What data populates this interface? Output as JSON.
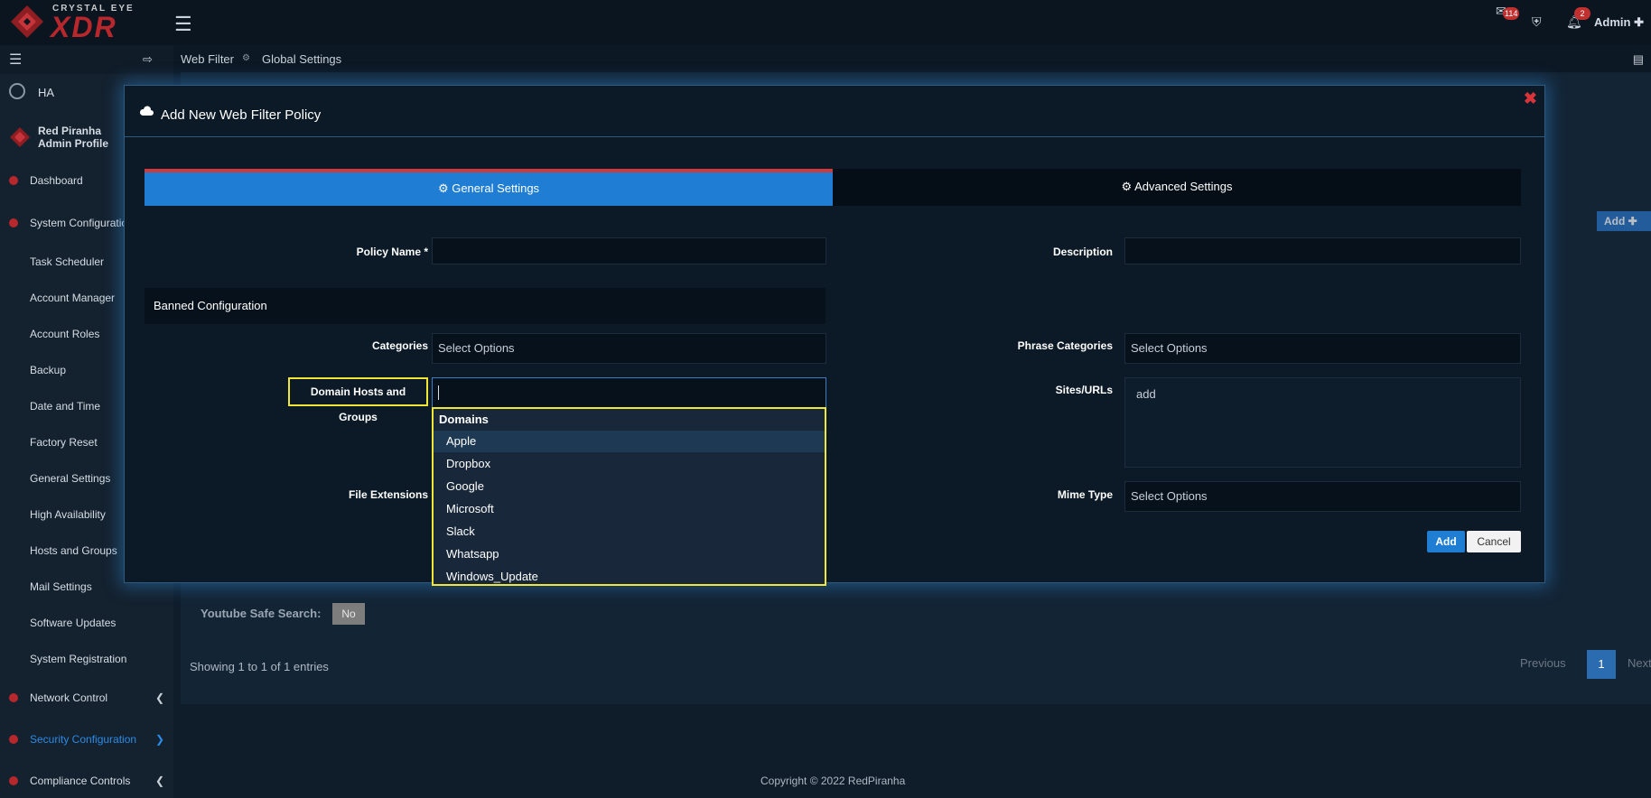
{
  "topbar": {
    "brand_small": "CRYSTAL EYE",
    "brand_main": "XDR",
    "mail_badge": "114",
    "alert_badge": "2",
    "admin_label": "Admin"
  },
  "sidebar": {
    "ha_label": "HA",
    "profile_name": "Red Piranha",
    "profile_role": "Admin Profile",
    "items": [
      {
        "label": "Dashboard"
      },
      {
        "label": "System Configuration"
      },
      {
        "label": "Task Scheduler"
      },
      {
        "label": "Account Manager"
      },
      {
        "label": "Account Roles"
      },
      {
        "label": "Backup"
      },
      {
        "label": "Date and Time"
      },
      {
        "label": "Factory Reset"
      },
      {
        "label": "General Settings"
      },
      {
        "label": "High Availability"
      },
      {
        "label": "Hosts and Groups"
      },
      {
        "label": "Mail Settings"
      },
      {
        "label": "Software Updates"
      },
      {
        "label": "System Registration"
      },
      {
        "label": "Network Control"
      },
      {
        "label": "Security Configuration"
      },
      {
        "label": "Compliance Controls"
      }
    ]
  },
  "breadcrumb": {
    "first": "Web Filter",
    "second": "Global Settings"
  },
  "background": {
    "add_button": "Add",
    "youtube_label": "Youtube Safe Search:",
    "youtube_value": "No",
    "showing": "Showing 1 to 1 of 1 entries",
    "prev": "Previous",
    "page": "1",
    "next": "Next",
    "copyright": "Copyright © 2022 RedPiranha"
  },
  "modal": {
    "title": "Add New Web Filter Policy",
    "tab_general": "General Settings",
    "tab_advanced": "Advanced Settings",
    "policy_name_label": "Policy Name *",
    "description_label": "Description",
    "banned_header": "Banned Configuration",
    "categories_label": "Categories",
    "categories_placeholder": "Select Options",
    "phrase_categories_label": "Phrase Categories",
    "phrase_categories_placeholder": "Select Options",
    "domain_label": "Domain Hosts and Groups",
    "sites_label": "Sites/URLs",
    "sites_value": "add",
    "file_ext_label": "File Extensions",
    "mime_label": "Mime Type",
    "mime_placeholder": "Select Options",
    "dropdown_group": "Domains",
    "dropdown_options": [
      "Apple",
      "Dropbox",
      "Google",
      "Microsoft",
      "Slack",
      "Whatsapp",
      "Windows_Update"
    ],
    "add_button": "Add",
    "cancel_button": "Cancel"
  },
  "colors": {
    "accent": "#1f7ed4",
    "brand": "#b7272c",
    "highlight": "#f0e635"
  }
}
